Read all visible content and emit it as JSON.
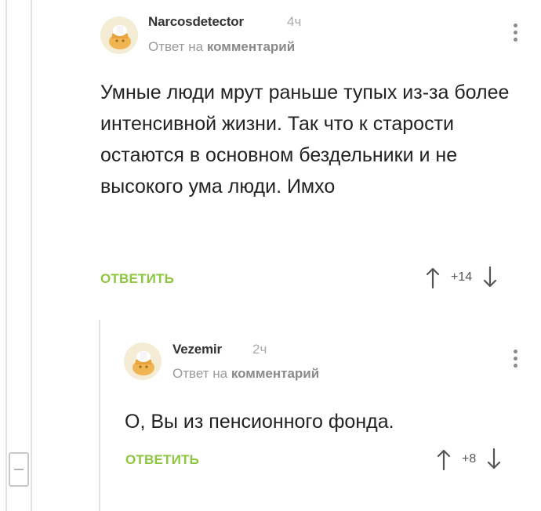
{
  "comments": [
    {
      "username": "Narcosdetector",
      "time": "4ч",
      "reply_prefix": "Ответ на",
      "reply_link": "комментарий",
      "text": "Умные люди мрут раньше тупых из-за более интенсивной жизни. Так что к старости остаются в основном бездельники и не высокого ума люди. Имхо",
      "reply_label": "ОТВЕТИТЬ",
      "rating": "+14"
    },
    {
      "username": "Vezemir",
      "time": "2ч",
      "reply_prefix": "Ответ на",
      "reply_link": "комментарий",
      "text": "О, Вы из пенсионного фонда.",
      "reply_label": "ОТВЕТИТЬ",
      "rating": "+8"
    }
  ],
  "colors": {
    "accent": "#8dc63f",
    "muted": "#9a9a9a",
    "thread_line": "#e3e3e3"
  },
  "icons": [
    "avatar-placeholder-icon",
    "more-vertical-icon",
    "arrow-up-icon",
    "arrow-down-icon",
    "collapse-minus-icon"
  ]
}
